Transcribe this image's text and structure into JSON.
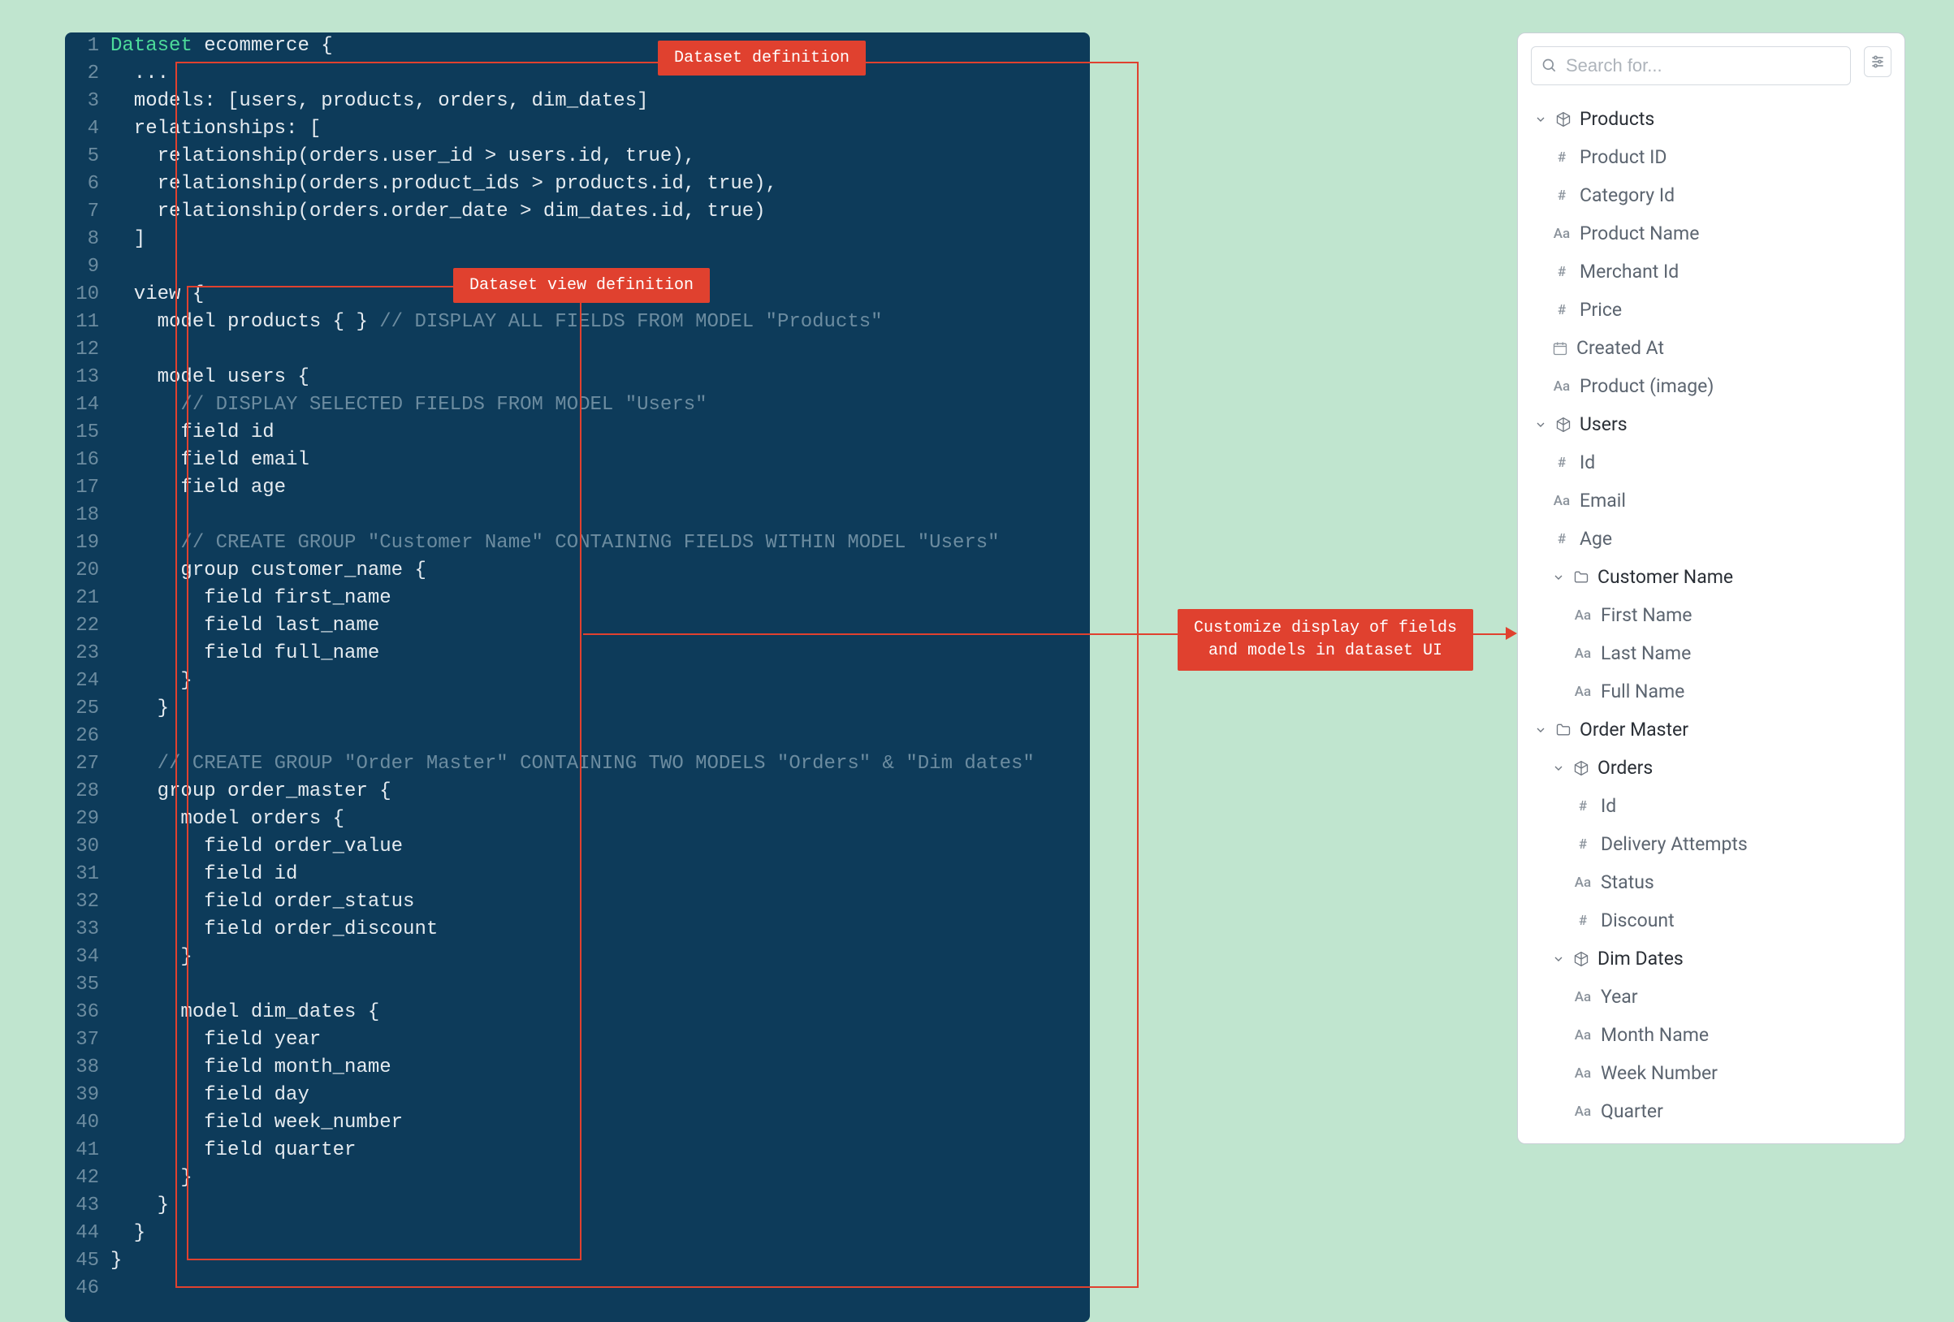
{
  "annotations": {
    "dataset_def": "Dataset definition",
    "view_def": "Dataset view definition",
    "customize": "Customize display of fields\nand models in dataset UI"
  },
  "code": {
    "lines": [
      {
        "n": 1,
        "segs": [
          [
            "kw",
            "Dataset"
          ],
          [
            "p",
            " ecommerce {"
          ]
        ]
      },
      {
        "n": 2,
        "segs": [
          [
            "p",
            "  ..."
          ]
        ]
      },
      {
        "n": 3,
        "segs": [
          [
            "p",
            "  models: [users, products, orders, dim_dates]"
          ]
        ]
      },
      {
        "n": 4,
        "segs": [
          [
            "p",
            "  relationships: ["
          ]
        ]
      },
      {
        "n": 5,
        "segs": [
          [
            "p",
            "    relationship(orders.user_id > users.id, true),"
          ]
        ]
      },
      {
        "n": 6,
        "segs": [
          [
            "p",
            "    relationship(orders.product_ids > products.id, true),"
          ]
        ]
      },
      {
        "n": 7,
        "segs": [
          [
            "p",
            "    relationship(orders.order_date > dim_dates.id, true)"
          ]
        ]
      },
      {
        "n": 8,
        "segs": [
          [
            "p",
            "  ]"
          ]
        ]
      },
      {
        "n": 9,
        "segs": [
          [
            "p",
            ""
          ]
        ]
      },
      {
        "n": 10,
        "segs": [
          [
            "p",
            "  view {"
          ]
        ]
      },
      {
        "n": 11,
        "segs": [
          [
            "p",
            "    model products { } "
          ],
          [
            "cm",
            "// DISPLAY ALL FIELDS FROM MODEL \"Products\""
          ]
        ]
      },
      {
        "n": 12,
        "segs": [
          [
            "p",
            ""
          ]
        ]
      },
      {
        "n": 13,
        "segs": [
          [
            "p",
            "    model users {"
          ]
        ]
      },
      {
        "n": 14,
        "segs": [
          [
            "p",
            "      "
          ],
          [
            "cm",
            "// DISPLAY SELECTED FIELDS FROM MODEL \"Users\""
          ]
        ]
      },
      {
        "n": 15,
        "segs": [
          [
            "p",
            "      field id"
          ]
        ]
      },
      {
        "n": 16,
        "segs": [
          [
            "p",
            "      field email"
          ]
        ]
      },
      {
        "n": 17,
        "segs": [
          [
            "p",
            "      field age"
          ]
        ]
      },
      {
        "n": 18,
        "segs": [
          [
            "p",
            ""
          ]
        ]
      },
      {
        "n": 19,
        "segs": [
          [
            "p",
            "      "
          ],
          [
            "cm",
            "// CREATE GROUP \"Customer Name\" CONTAINING FIELDS WITHIN MODEL \"Users\""
          ]
        ]
      },
      {
        "n": 20,
        "segs": [
          [
            "p",
            "      group customer_name {"
          ]
        ]
      },
      {
        "n": 21,
        "segs": [
          [
            "p",
            "        field first_name"
          ]
        ]
      },
      {
        "n": 22,
        "segs": [
          [
            "p",
            "        field last_name"
          ]
        ]
      },
      {
        "n": 23,
        "segs": [
          [
            "p",
            "        field full_name"
          ]
        ]
      },
      {
        "n": 24,
        "segs": [
          [
            "p",
            "      }"
          ]
        ]
      },
      {
        "n": 25,
        "segs": [
          [
            "p",
            "    }"
          ]
        ]
      },
      {
        "n": 26,
        "segs": [
          [
            "p",
            ""
          ]
        ]
      },
      {
        "n": 27,
        "segs": [
          [
            "p",
            "    "
          ],
          [
            "cm",
            "// CREATE GROUP \"Order Master\" CONTAINING TWO MODELS \"Orders\" & \"Dim dates\""
          ]
        ]
      },
      {
        "n": 28,
        "segs": [
          [
            "p",
            "    group order_master {"
          ]
        ]
      },
      {
        "n": 29,
        "segs": [
          [
            "p",
            "      model orders {"
          ]
        ]
      },
      {
        "n": 30,
        "segs": [
          [
            "p",
            "        field order_value"
          ]
        ]
      },
      {
        "n": 31,
        "segs": [
          [
            "p",
            "        field id"
          ]
        ]
      },
      {
        "n": 32,
        "segs": [
          [
            "p",
            "        field order_status"
          ]
        ]
      },
      {
        "n": 33,
        "segs": [
          [
            "p",
            "        field order_discount"
          ]
        ]
      },
      {
        "n": 34,
        "segs": [
          [
            "p",
            "      }"
          ]
        ]
      },
      {
        "n": 35,
        "segs": [
          [
            "p",
            ""
          ]
        ]
      },
      {
        "n": 36,
        "segs": [
          [
            "p",
            "      model dim_dates {"
          ]
        ]
      },
      {
        "n": 37,
        "segs": [
          [
            "p",
            "        field year"
          ]
        ]
      },
      {
        "n": 38,
        "segs": [
          [
            "p",
            "        field month_name"
          ]
        ]
      },
      {
        "n": 39,
        "segs": [
          [
            "p",
            "        field day"
          ]
        ]
      },
      {
        "n": 40,
        "segs": [
          [
            "p",
            "        field week_number"
          ]
        ]
      },
      {
        "n": 41,
        "segs": [
          [
            "p",
            "        field quarter"
          ]
        ]
      },
      {
        "n": 42,
        "segs": [
          [
            "p",
            "      }"
          ]
        ]
      },
      {
        "n": 43,
        "segs": [
          [
            "p",
            "    }"
          ]
        ]
      },
      {
        "n": 44,
        "segs": [
          [
            "p",
            "  }"
          ]
        ]
      },
      {
        "n": 45,
        "segs": [
          [
            "p",
            "}"
          ]
        ]
      },
      {
        "n": 46,
        "segs": [
          [
            "p",
            ""
          ]
        ]
      }
    ]
  },
  "panel": {
    "search_placeholder": "Search for...",
    "tree": [
      {
        "type": "model",
        "label": "Products",
        "depth": 0,
        "open": true,
        "children": [
          {
            "type": "num",
            "label": "Product ID"
          },
          {
            "type": "num",
            "label": "Category Id"
          },
          {
            "type": "txt",
            "label": "Product Name"
          },
          {
            "type": "num",
            "label": "Merchant Id"
          },
          {
            "type": "num",
            "label": "Price"
          },
          {
            "type": "date",
            "label": "Created At"
          },
          {
            "type": "txt",
            "label": "Product (image)"
          }
        ]
      },
      {
        "type": "model",
        "label": "Users",
        "depth": 0,
        "open": true,
        "children": [
          {
            "type": "num",
            "label": "Id"
          },
          {
            "type": "txt",
            "label": "Email"
          },
          {
            "type": "num",
            "label": "Age"
          },
          {
            "type": "folder",
            "label": "Customer Name",
            "depth": 1,
            "open": true,
            "children": [
              {
                "type": "txt",
                "label": "First Name"
              },
              {
                "type": "txt",
                "label": "Last Name"
              },
              {
                "type": "txt",
                "label": "Full Name"
              }
            ]
          }
        ]
      },
      {
        "type": "folder",
        "label": "Order Master",
        "depth": 0,
        "open": true,
        "children": [
          {
            "type": "model",
            "label": "Orders",
            "depth": 1,
            "open": true,
            "children": [
              {
                "type": "num",
                "label": "Id"
              },
              {
                "type": "num",
                "label": "Delivery Attempts"
              },
              {
                "type": "txt",
                "label": "Status"
              },
              {
                "type": "num",
                "label": "Discount"
              }
            ]
          },
          {
            "type": "model",
            "label": "Dim Dates",
            "depth": 1,
            "open": true,
            "children": [
              {
                "type": "txt",
                "label": "Year"
              },
              {
                "type": "txt",
                "label": "Month Name"
              },
              {
                "type": "txt",
                "label": "Week Number"
              },
              {
                "type": "txt",
                "label": "Quarter"
              }
            ]
          }
        ]
      }
    ]
  }
}
